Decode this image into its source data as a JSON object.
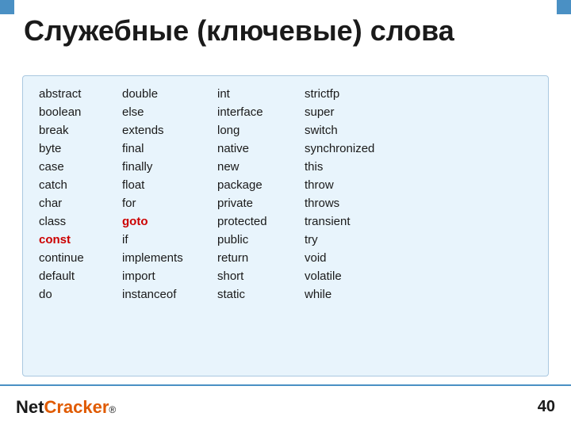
{
  "title": "Служебные (ключевые) слова",
  "keywords": [
    [
      {
        "text": "abstract",
        "style": "normal"
      },
      {
        "text": "double",
        "style": "normal"
      },
      {
        "text": "int",
        "style": "normal"
      },
      {
        "text": "strictfp",
        "style": "normal"
      }
    ],
    [
      {
        "text": "boolean",
        "style": "normal"
      },
      {
        "text": "else",
        "style": "normal"
      },
      {
        "text": "interface",
        "style": "normal"
      },
      {
        "text": "super",
        "style": "normal"
      }
    ],
    [
      {
        "text": "break",
        "style": "normal"
      },
      {
        "text": "extends",
        "style": "normal"
      },
      {
        "text": "long",
        "style": "normal"
      },
      {
        "text": "switch",
        "style": "normal"
      }
    ],
    [
      {
        "text": "byte",
        "style": "normal"
      },
      {
        "text": "final",
        "style": "normal"
      },
      {
        "text": "native",
        "style": "normal"
      },
      {
        "text": "synchronized",
        "style": "normal"
      }
    ],
    [
      {
        "text": "case",
        "style": "normal"
      },
      {
        "text": "finally",
        "style": "normal"
      },
      {
        "text": "new",
        "style": "normal"
      },
      {
        "text": "this",
        "style": "normal"
      }
    ],
    [
      {
        "text": "catch",
        "style": "normal"
      },
      {
        "text": "float",
        "style": "normal"
      },
      {
        "text": "package",
        "style": "normal"
      },
      {
        "text": "throw",
        "style": "normal"
      }
    ],
    [
      {
        "text": "char",
        "style": "normal"
      },
      {
        "text": "for",
        "style": "normal"
      },
      {
        "text": "private",
        "style": "normal"
      },
      {
        "text": "throws",
        "style": "normal"
      }
    ],
    [
      {
        "text": "class",
        "style": "normal"
      },
      {
        "text": "goto",
        "style": "red"
      },
      {
        "text": "protected",
        "style": "normal"
      },
      {
        "text": "transient",
        "style": "normal"
      }
    ],
    [
      {
        "text": "const",
        "style": "red"
      },
      {
        "text": "if",
        "style": "normal"
      },
      {
        "text": "public",
        "style": "normal"
      },
      {
        "text": "try",
        "style": "normal"
      }
    ],
    [
      {
        "text": "continue",
        "style": "normal"
      },
      {
        "text": "implements",
        "style": "normal"
      },
      {
        "text": "return",
        "style": "normal"
      },
      {
        "text": "void",
        "style": "normal"
      }
    ],
    [
      {
        "text": "default",
        "style": "normal"
      },
      {
        "text": "import",
        "style": "normal"
      },
      {
        "text": "short",
        "style": "normal"
      },
      {
        "text": "volatile",
        "style": "normal"
      }
    ],
    [
      {
        "text": "do",
        "style": "normal"
      },
      {
        "text": "instanceof",
        "style": "normal"
      },
      {
        "text": "static",
        "style": "normal"
      },
      {
        "text": "while",
        "style": "normal"
      }
    ]
  ],
  "logo": {
    "net": "Net",
    "cracker": "Cracker",
    "reg": "®"
  },
  "page_number": "40"
}
